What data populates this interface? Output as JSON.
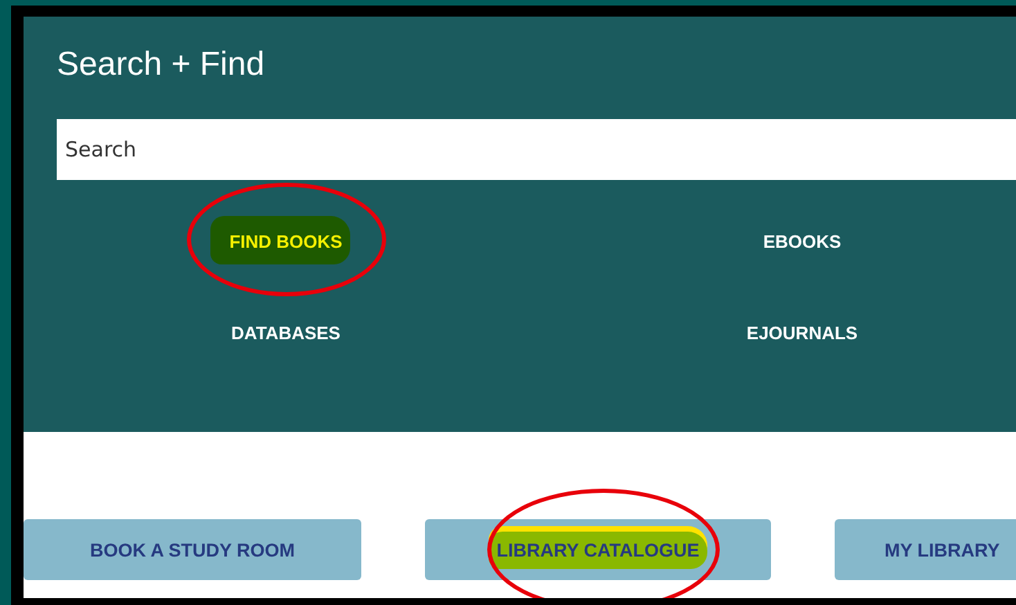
{
  "title": "Search + Find",
  "search": {
    "placeholder": "Search"
  },
  "links": [
    {
      "label": "FIND BOOKS",
      "circled": true,
      "color": "#1e5a00"
    },
    {
      "label": "EBOOKS",
      "circled": false
    },
    {
      "label": "DATABASES",
      "circled": false
    },
    {
      "label": "EJOURNALS",
      "circled": false
    }
  ],
  "buttons": [
    {
      "label": "BOOK A STUDY ROOM",
      "circled": false
    },
    {
      "label": "LIBRARY CATALOGUE",
      "circled": true,
      "color": "#8ab800"
    },
    {
      "label": "MY LIBRARY",
      "circled": false
    }
  ]
}
